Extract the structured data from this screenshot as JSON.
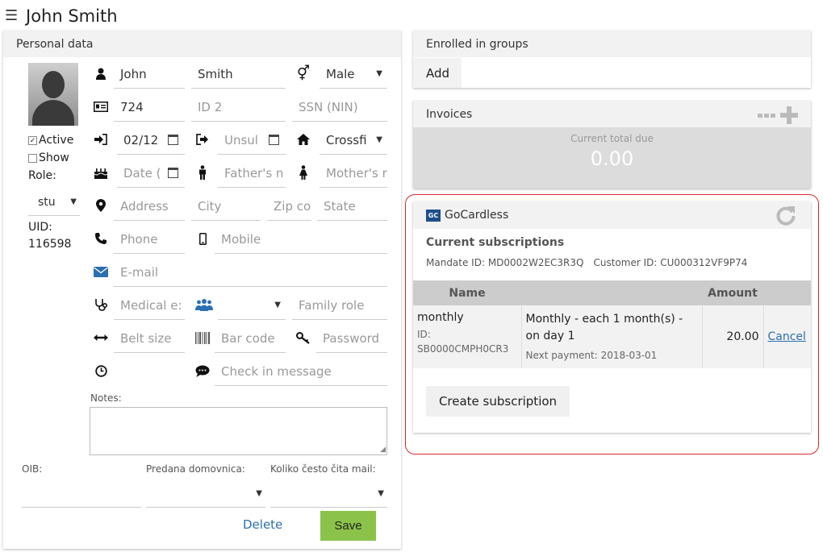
{
  "header": {
    "title": "John Smith"
  },
  "personal": {
    "title": "Personal data",
    "active_label": "Active",
    "show_label": "Show",
    "role_label": "Role:",
    "role_value": "stu",
    "uid_label": "UID:",
    "uid_value": "116598",
    "first_name": "John",
    "last_name": "Smith",
    "gender": "Male",
    "id_value": "724",
    "id2_placeholder": "ID 2",
    "ssn_placeholder": "SSN (NIN)",
    "date_in": "02/12",
    "unsub_placeholder": "Unsul",
    "club": "Crossfi",
    "birth_placeholder": "Date (",
    "father_placeholder": "Father's n",
    "mother_placeholder": "Mother's r",
    "address_placeholder": "Address",
    "city_placeholder": "City",
    "zip_placeholder": "Zip co",
    "state_placeholder": "State",
    "phone_placeholder": "Phone",
    "mobile_placeholder": "Mobile",
    "email_placeholder": "E-mail",
    "medical_placeholder": "Medical e:",
    "family_role_placeholder": "Family role",
    "belt_placeholder": "Belt size",
    "barcode_placeholder": "Bar code",
    "password_placeholder": "Password",
    "checkin_placeholder": "Check in message",
    "notes_label": "Notes:",
    "oib_label": "OIB:",
    "domovnica_label": "Predana domovnica:",
    "mail_label": "Koliko često čita mail:",
    "delete_label": "Delete",
    "save_label": "Save"
  },
  "groups": {
    "title": "Enrolled in groups",
    "add_label": "Add"
  },
  "invoices": {
    "title": "Invoices",
    "due_label": "Current total due",
    "due_value": "0.00"
  },
  "gocardless": {
    "logo_text": "GC",
    "title": "GoCardless",
    "subs_title": "Current subscriptions",
    "mandate": "Mandate ID: MD0002W2EC3R3Q",
    "customer": "Customer ID: CU000312VF9P74",
    "columns": {
      "name": "Name",
      "amount": "Amount"
    },
    "row": {
      "name": "monthly",
      "id_label": "ID:",
      "id_value": "SB0000CMPH0CR3",
      "description": "Monthly - each 1 month(s) - on day 1",
      "next_payment": "Next payment: 2018-03-01",
      "amount": "20.00",
      "cancel_label": "Cancel"
    },
    "create_label": "Create subscription"
  }
}
